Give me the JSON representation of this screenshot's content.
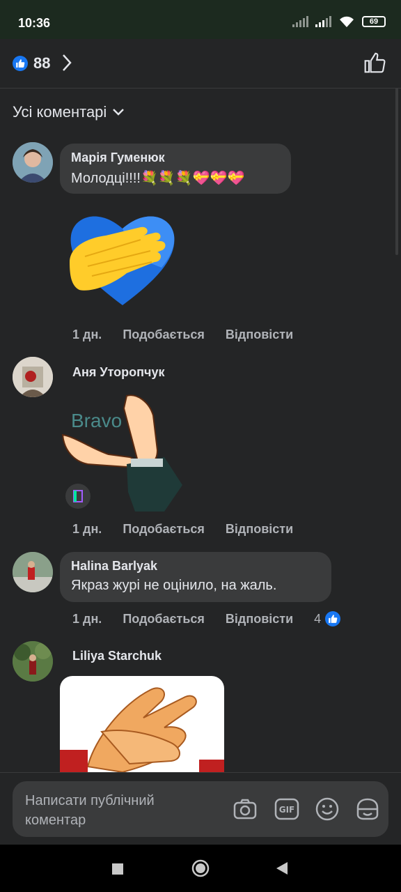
{
  "status": {
    "time": "10:36",
    "battery": "69"
  },
  "header": {
    "reaction_count": "88"
  },
  "filter": {
    "label": "Усі коментарі"
  },
  "comments": [
    {
      "author": "Марія Гуменюк",
      "text": "Молодці!!!!💐💐💐💝💝💝",
      "time": "1 дн.",
      "like": "Подобається",
      "reply": "Відповісти"
    },
    {
      "author": "Аня Уторопчук",
      "sticker_text": "Bravo",
      "time": "1 дн.",
      "like": "Подобається",
      "reply": "Відповісти"
    },
    {
      "author": "Halina Barlyak",
      "text": "Якраз журі не оцінило, на жаль.",
      "time": "1 дн.",
      "like": "Подобається",
      "reply": "Відповісти",
      "likes": "4"
    },
    {
      "author": "Liliya Starchuk"
    }
  ],
  "composer": {
    "placeholder": "Написати публічний коментар"
  },
  "icons": [
    "like-icon",
    "chevron-right-icon",
    "thumbs-up-icon",
    "chevron-down-icon",
    "camera-icon",
    "gif-icon",
    "emoji-icon",
    "sticker-icon"
  ],
  "colors": {
    "accent": "#1877f2",
    "background": "#242526",
    "bubble": "#3a3b3c"
  }
}
